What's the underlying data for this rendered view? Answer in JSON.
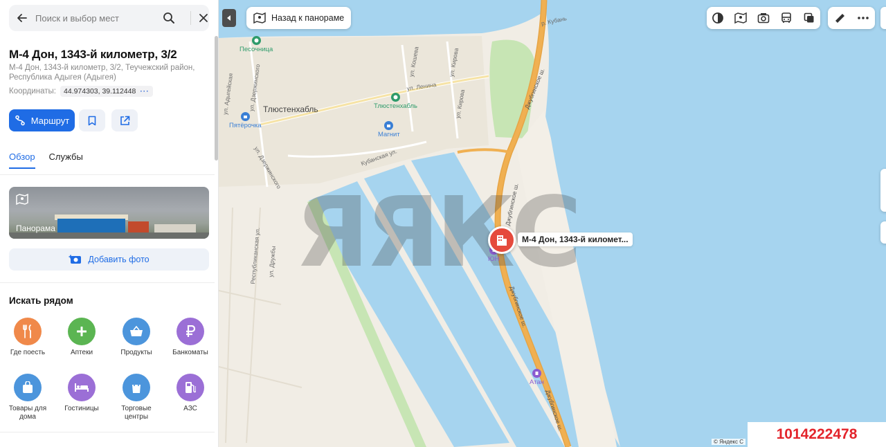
{
  "search": {
    "placeholder": "Поиск и выбор мест"
  },
  "place": {
    "title": "М-4 Дон, 1343-й километр, 3/2",
    "address": "М-4 Дон, 1343-й километр, 3/2, Теучежский район, Республика Адыгея (Адыгея)",
    "coords_label": "Координаты:",
    "coords_value": "44.974303, 39.112448"
  },
  "actions": {
    "route_label": "Маршрут"
  },
  "tabs": [
    {
      "label": "Обзор",
      "active": true
    },
    {
      "label": "Службы",
      "active": false
    }
  ],
  "panorama": {
    "label": "Панорама"
  },
  "add_photo_label": "Добавить фото",
  "nearby": {
    "title": "Искать рядом",
    "categories": [
      {
        "label": "Где поесть",
        "icon": "fork-knife-icon",
        "color": "#f0894a"
      },
      {
        "label": "Аптеки",
        "icon": "plus-icon",
        "color": "#5bb552"
      },
      {
        "label": "Продукты",
        "icon": "basket-icon",
        "color": "#4c95dc"
      },
      {
        "label": "Банкоматы",
        "icon": "ruble-icon",
        "color": "#9b6fd6"
      },
      {
        "label": "Товары для дома",
        "icon": "bag-icon",
        "color": "#4c95dc"
      },
      {
        "label": "Гостиницы",
        "icon": "bed-icon",
        "color": "#9b6fd6"
      },
      {
        "label": "Торговые центры",
        "icon": "shopping-bag-icon",
        "color": "#4c95dc"
      },
      {
        "label": "АЗС",
        "icon": "fuel-icon",
        "color": "#9b6fd6"
      }
    ]
  },
  "map": {
    "back_to_panorama": "Назад к панораме",
    "marker_label": "М-4 Дон, 1343-й километ...",
    "watermark": "ЯЯКС",
    "copyright": "© Яндекс  С",
    "labels": {
      "town": "Тлюстенхабль",
      "river": "р. Кубань",
      "street_lenina": "ул. Ленина",
      "street_kosheva": "ул. Кошева",
      "street_kirova1": "ул. Кирова",
      "street_kirova2": "ул. Кирова",
      "street_dzerzhinskogo1": "ул. Дзержинского",
      "street_dzerzhinskogo2": "ул. Дзержинского",
      "street_adygeiskaya": "ул. Адыгейская",
      "street_kubanskaya": "Кубанская ул.",
      "street_respublikanskaya": "Республиканская ул.",
      "street_druzhby": "ул. Дружбы",
      "highway1": "Джубгинское ш.",
      "highway2": "Джубгинское ш.",
      "highway3": "Джубгинское ш.",
      "highway4": "Джубгинское ш."
    },
    "pois": {
      "pesochnitsa": "Песочница",
      "tlyustenkhabl": "Тлюстенхабль",
      "pyaterochka": "Пятёрочка",
      "magnit": "Магнит",
      "yun": "ЮН",
      "atan": "Атан"
    },
    "colors": {
      "water": "#a6d4ef",
      "land": "#f1ede5",
      "highway": "#f0b052",
      "green": "#c7e5b4"
    }
  },
  "listing_id": "1014222478"
}
